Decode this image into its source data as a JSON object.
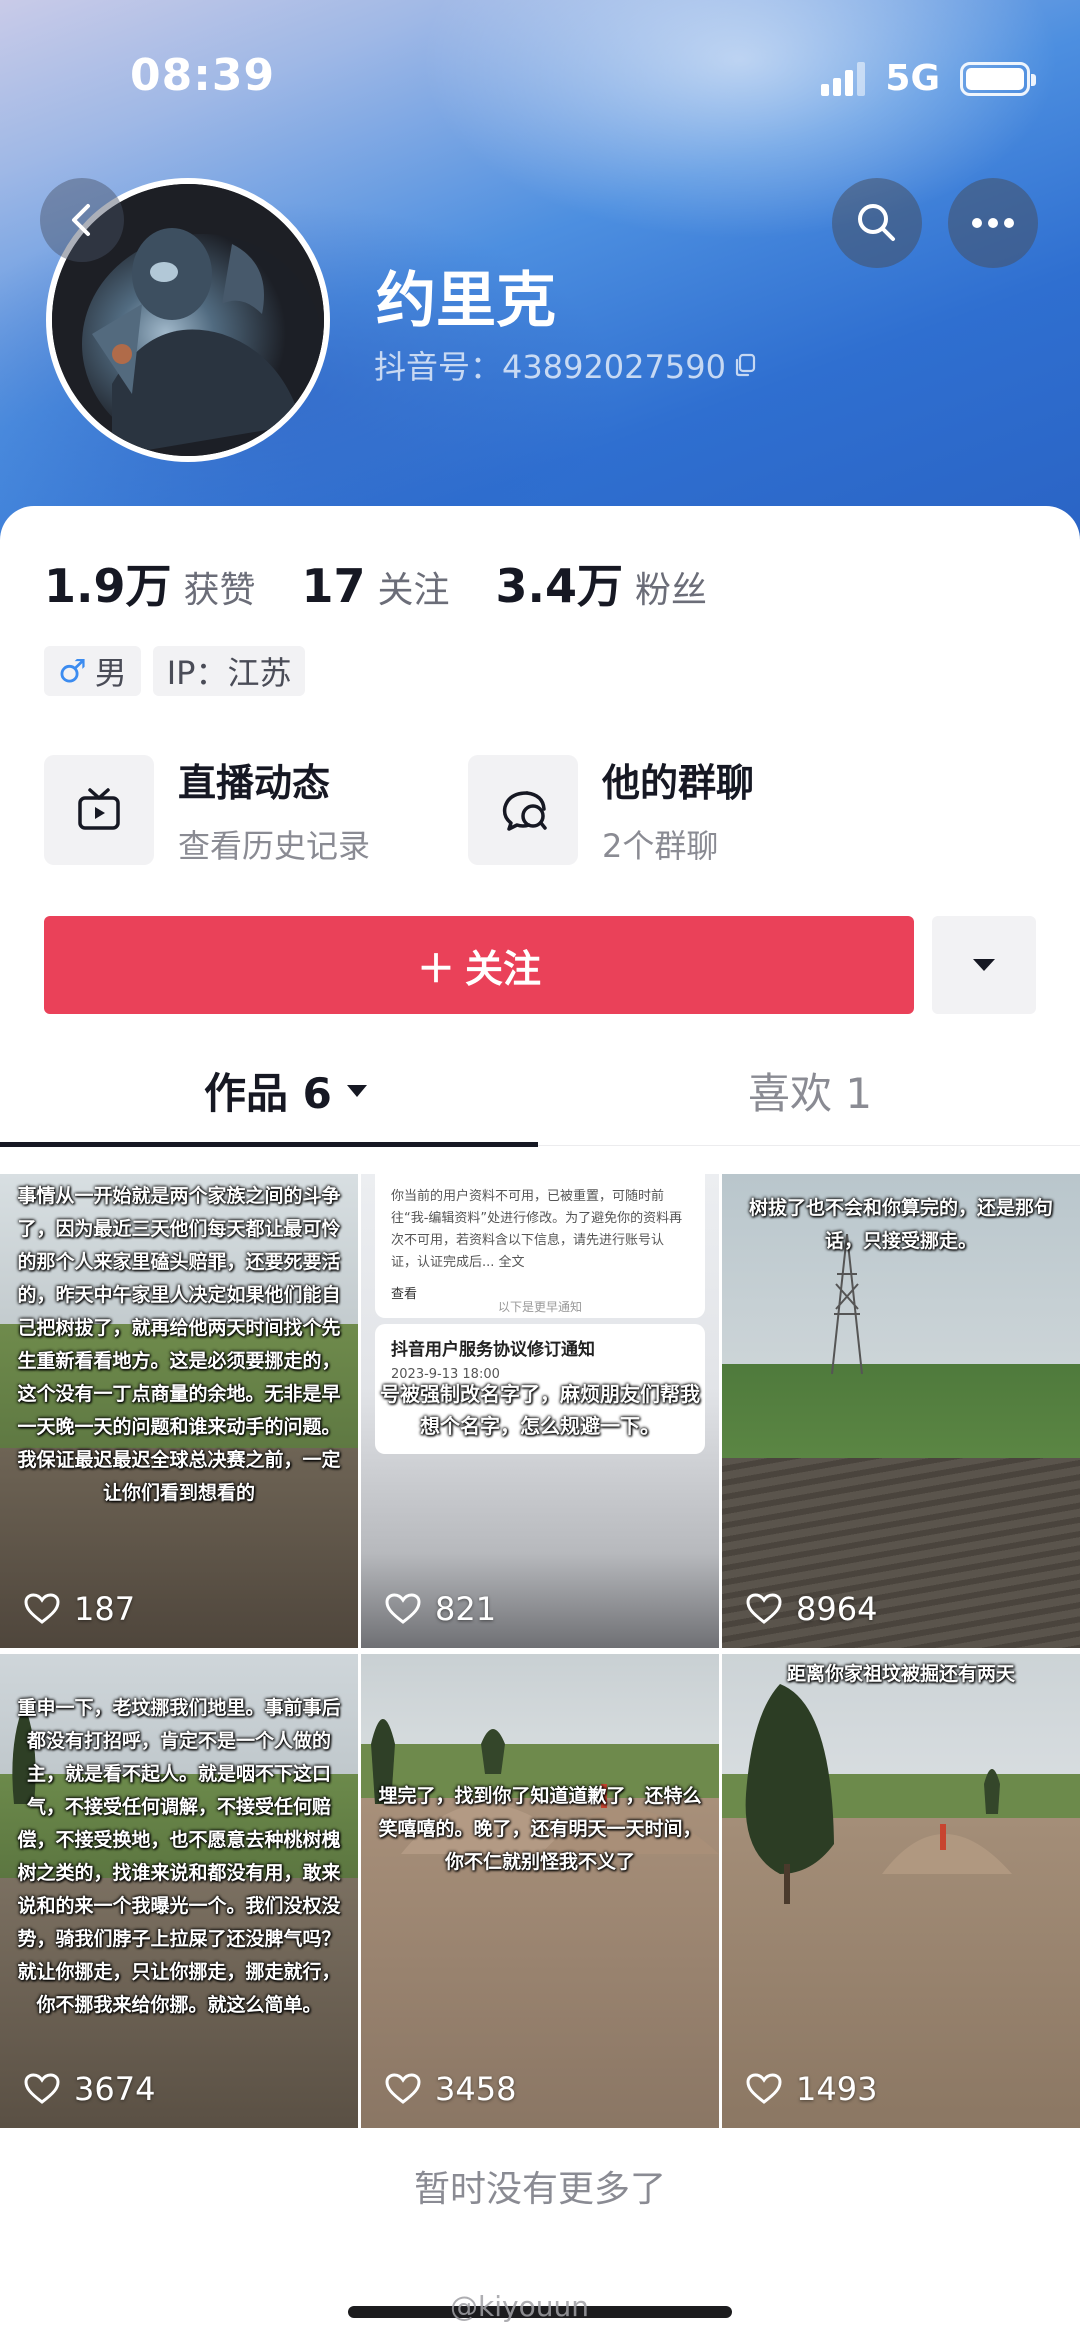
{
  "status_bar": {
    "time": "08:39",
    "network": "5G"
  },
  "profile": {
    "name": "约里克",
    "douyin_id": "抖音号：43892027590",
    "stats": [
      {
        "value": "1.9万",
        "label": "获赞"
      },
      {
        "value": "17",
        "label": "关注"
      },
      {
        "value": "3.4万",
        "label": "粉丝"
      }
    ],
    "tags": {
      "gender_symbol": "♂",
      "gender": "男",
      "ip": "IP：江苏"
    }
  },
  "features": {
    "live": {
      "title": "直播动态",
      "subtitle": "查看历史记录"
    },
    "group": {
      "title": "他的群聊",
      "subtitle": "2个群聊"
    }
  },
  "actions": {
    "follow_label": "关注",
    "follow_prefix": "＋"
  },
  "tabs": {
    "works": {
      "label": "作品 6"
    },
    "likes": {
      "label": "喜欢 1"
    }
  },
  "posts": [
    {
      "likes": "187",
      "caption": "事情从一开始就是两个家族之间的斗争了，因为最近三天他们每天都让最可怜的那个人来家里磕头赔罪，还要死要活的，昨天中午家里人决定如果他们能自己把树拔了，就再给他两天时间找个先生重新看看地方。这是必须要挪走的，这个没有一丁点商量的余地。无非是早一天晚一天的问题和谁来动手的问题。我保证最迟最迟全球总决赛之前，一定让你们看到想看的"
    },
    {
      "likes": "821",
      "screenshot": {
        "top_text": "你当前的用户资料不可用，已被重置，可随时前往“我-编辑资料”处进行修改。为了避免你的资料再次不可用，若资料含以下信息，请先进行账号认证，认证完成后... 全文",
        "view": "查看",
        "divider": "以下是更早通知",
        "notice_title": "抖音用户服务协议修订通知",
        "notice_date": "2023-9-13 18:00"
      },
      "caption": "号被强制改名字了，麻烦朋友们帮我想个名字，怎么规避一下。"
    },
    {
      "likes": "8964",
      "caption": "树拔了也不会和你算完的，还是那句话，只接受挪走。"
    },
    {
      "likes": "3674",
      "caption": "重申一下，老坟挪我们地里。事前事后都没有打招呼，肯定不是一个人做的主，就是看不起人。就是咽不下这口气，不接受任何调解，不接受任何赔偿，不接受换地，也不愿意去种桃树槐树之类的，找谁来说和都没有用，敢来说和的来一个我曝光一个。我们没权没势，骑我们脖子上拉屎了还没脾气吗？就让你挪走，只让你挪走，挪走就行，你不挪我来给你挪。就这么简单。"
    },
    {
      "likes": "3458",
      "caption": "埋完了，找到你了知道道歉了，还特么笑嘻嘻的。晚了，还有明天一天时间，你不仁就别怪我不义了"
    },
    {
      "likes": "1493",
      "caption": "距离你家祖坟被掘还有两天"
    }
  ],
  "footer": {
    "no_more": "暂时没有更多了",
    "watermark": "@kiyouun"
  },
  "colors": {
    "follow_button": "#ea4159",
    "male_icon": "#3c8cf0"
  }
}
